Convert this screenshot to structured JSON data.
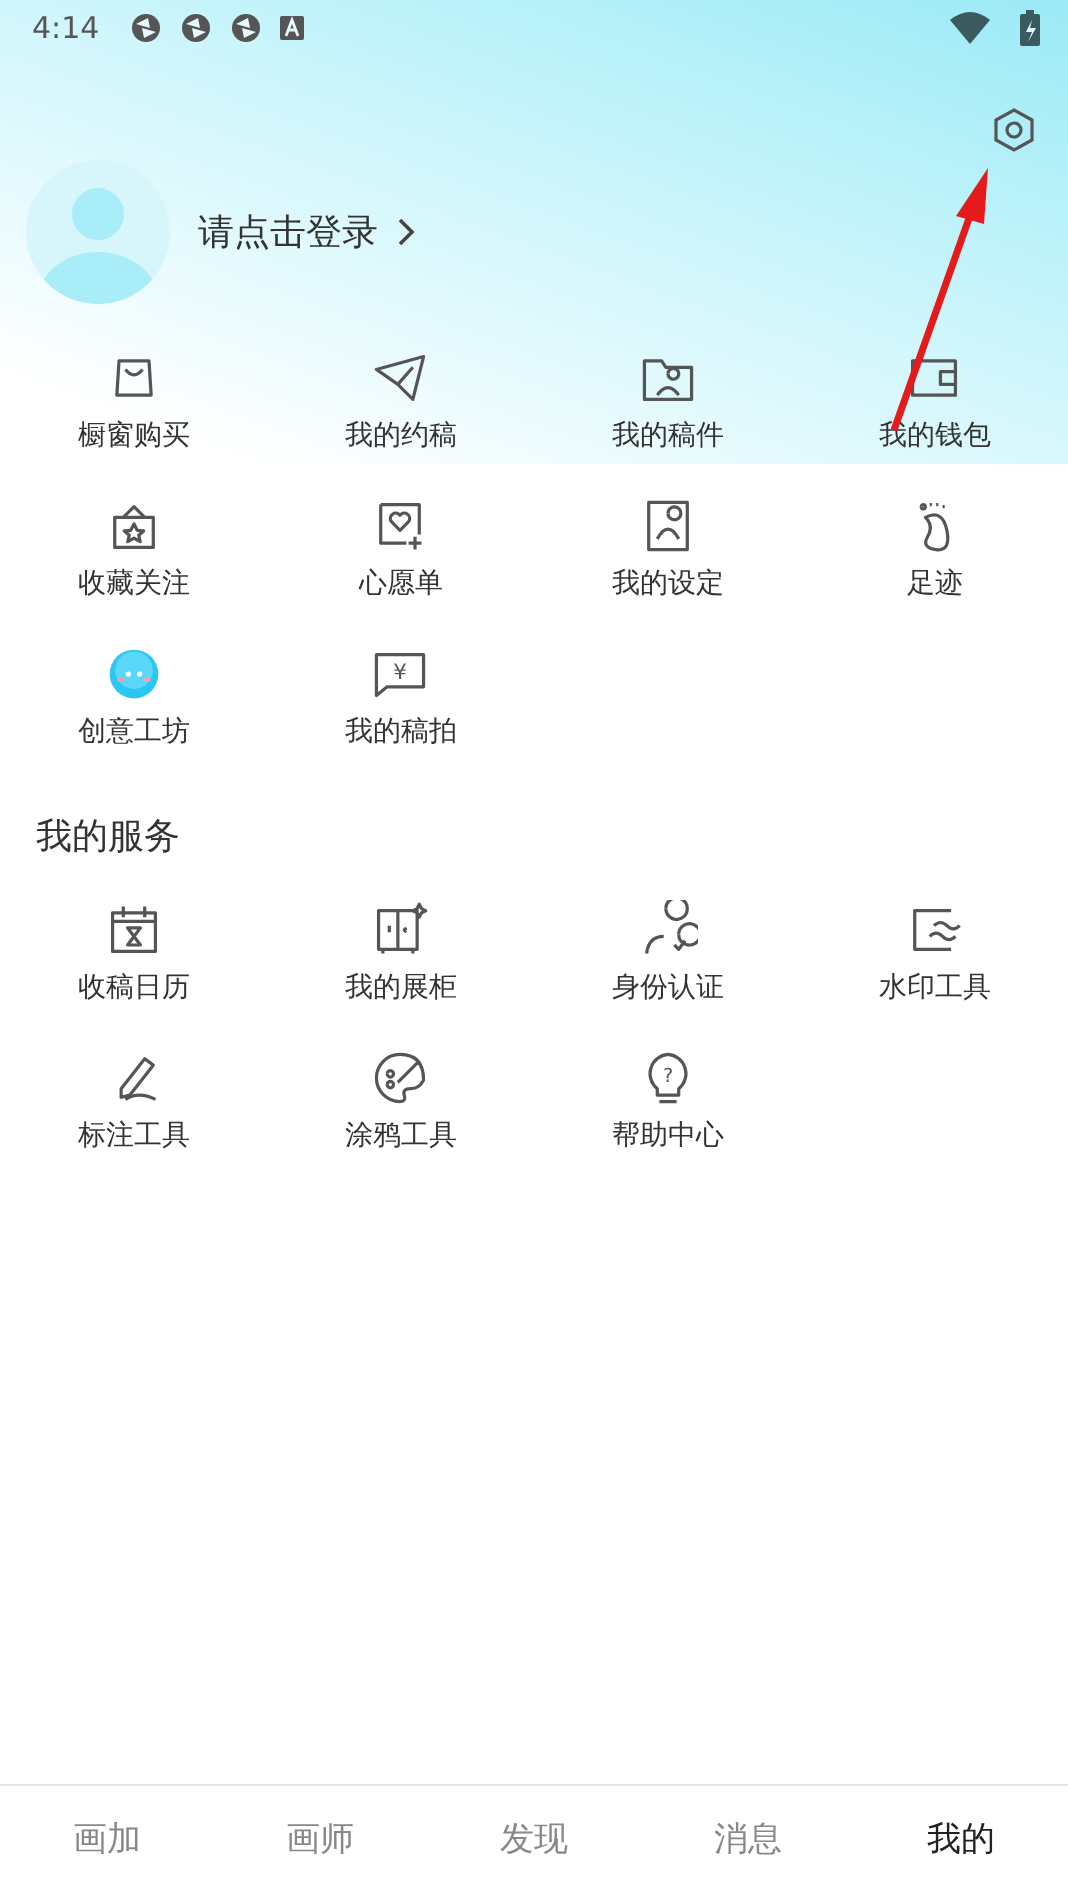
{
  "status_bar": {
    "time": "4:14"
  },
  "profile": {
    "login_prompt": "请点击登录"
  },
  "quick_grid": [
    {
      "label": "橱窗购买"
    },
    {
      "label": "我的约稿"
    },
    {
      "label": "我的稿件"
    },
    {
      "label": "我的钱包"
    },
    {
      "label": "收藏关注"
    },
    {
      "label": "心愿单"
    },
    {
      "label": "我的设定"
    },
    {
      "label": "足迹"
    },
    {
      "label": "创意工坊"
    },
    {
      "label": "我的稿拍",
      "icon_text": "¥"
    }
  ],
  "services": {
    "title": "我的服务",
    "items": [
      {
        "label": "收稿日历"
      },
      {
        "label": "我的展柜"
      },
      {
        "label": "身份认证"
      },
      {
        "label": "水印工具"
      },
      {
        "label": "标注工具"
      },
      {
        "label": "涂鸦工具"
      },
      {
        "label": "帮助中心",
        "icon_text": "?"
      }
    ]
  },
  "tab_bar": [
    {
      "label": "画加",
      "selected": false
    },
    {
      "label": "画师",
      "selected": false
    },
    {
      "label": "发现",
      "selected": false
    },
    {
      "label": "消息",
      "selected": false
    },
    {
      "label": "我的",
      "selected": true
    }
  ]
}
